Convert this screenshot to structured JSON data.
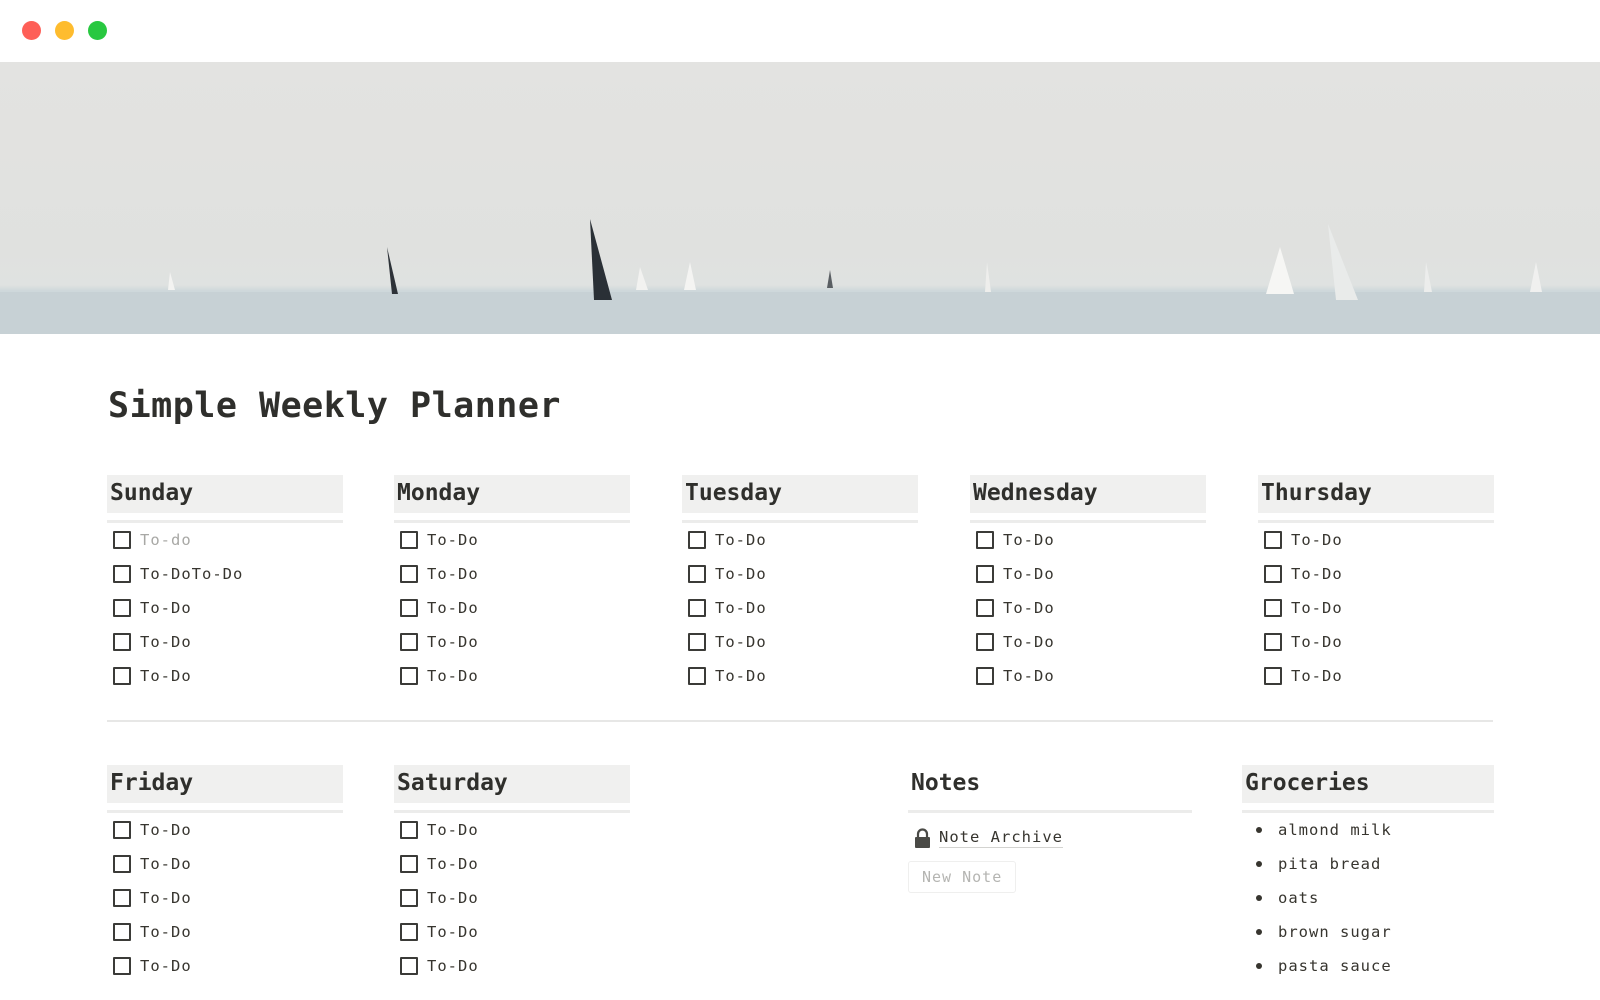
{
  "window": {
    "controls": [
      "close",
      "minimize",
      "maximize"
    ]
  },
  "cover": {
    "description": "hazy sea with sailboats"
  },
  "page": {
    "title": "Simple Weekly Planner"
  },
  "days": [
    {
      "name": "Sunday",
      "todos": [
        {
          "label": "To-do",
          "placeholder": true,
          "checked": false
        },
        {
          "label": "To-DoTo-Do",
          "checked": false
        },
        {
          "label": "To-Do",
          "checked": false
        },
        {
          "label": "To-Do",
          "checked": false
        },
        {
          "label": "To-Do",
          "checked": false
        }
      ]
    },
    {
      "name": "Monday",
      "todos": [
        {
          "label": "To-Do",
          "checked": false
        },
        {
          "label": "To-Do",
          "checked": false
        },
        {
          "label": "To-Do",
          "checked": false
        },
        {
          "label": "To-Do",
          "checked": false
        },
        {
          "label": "To-Do",
          "checked": false
        }
      ]
    },
    {
      "name": "Tuesday",
      "todos": [
        {
          "label": "To-Do",
          "checked": false
        },
        {
          "label": "To-Do",
          "checked": false
        },
        {
          "label": "To-Do",
          "checked": false
        },
        {
          "label": "To-Do",
          "checked": false
        },
        {
          "label": "To-Do",
          "checked": false
        }
      ]
    },
    {
      "name": "Wednesday",
      "todos": [
        {
          "label": "To-Do",
          "checked": false
        },
        {
          "label": "To-Do",
          "checked": false
        },
        {
          "label": "To-Do",
          "checked": false
        },
        {
          "label": "To-Do",
          "checked": false
        },
        {
          "label": "To-Do",
          "checked": false
        }
      ]
    },
    {
      "name": "Thursday",
      "todos": [
        {
          "label": "To-Do",
          "checked": false
        },
        {
          "label": "To-Do",
          "checked": false
        },
        {
          "label": "To-Do",
          "checked": false
        },
        {
          "label": "To-Do",
          "checked": false
        },
        {
          "label": "To-Do",
          "checked": false
        }
      ]
    },
    {
      "name": "Friday",
      "todos": [
        {
          "label": "To-Do",
          "checked": false
        },
        {
          "label": "To-Do",
          "checked": false
        },
        {
          "label": "To-Do",
          "checked": false
        },
        {
          "label": "To-Do",
          "checked": false
        },
        {
          "label": "To-Do",
          "checked": false
        }
      ]
    },
    {
      "name": "Saturday",
      "todos": [
        {
          "label": "To-Do",
          "checked": false
        },
        {
          "label": "To-Do",
          "checked": false
        },
        {
          "label": "To-Do",
          "checked": false
        },
        {
          "label": "To-Do",
          "checked": false
        },
        {
          "label": "To-Do",
          "checked": false
        }
      ]
    }
  ],
  "notes": {
    "title": "Notes",
    "archive_link": {
      "label": "Note Archive",
      "icon": "lock-icon"
    },
    "new_note_button": "New Note"
  },
  "groceries": {
    "title": "Groceries",
    "items": [
      "almond milk",
      "pita bread",
      "oats",
      "brown sugar",
      "pasta sauce"
    ]
  }
}
